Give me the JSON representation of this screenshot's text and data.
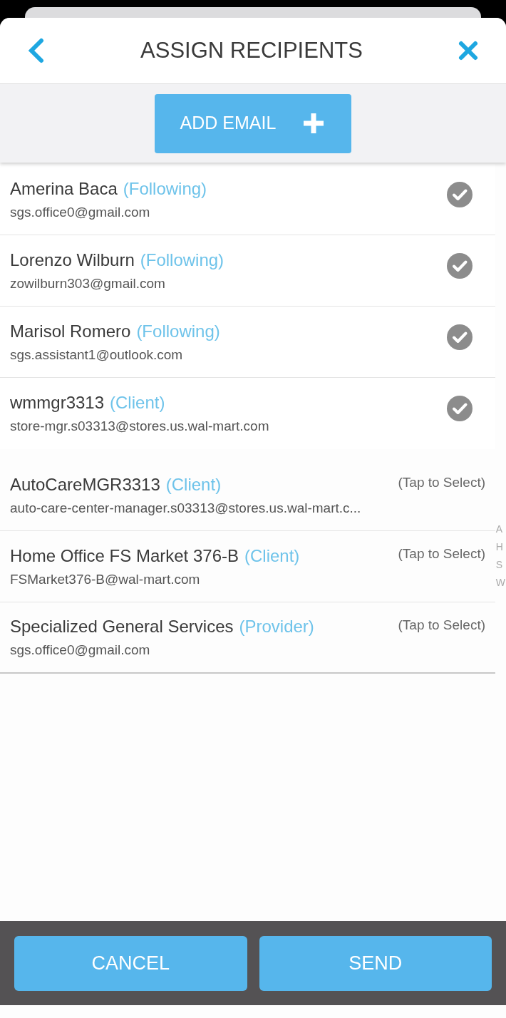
{
  "header": {
    "title": "ASSIGN RECIPIENTS"
  },
  "add_button": {
    "label": "ADD EMAIL"
  },
  "recipient_groups": [
    [
      {
        "name": "Amerina Baca",
        "role": "(Following)",
        "email": "sgs.office0@gmail.com",
        "selected": true
      },
      {
        "name": "Lorenzo Wilburn",
        "role": "(Following)",
        "email": "zowilburn303@gmail.com",
        "selected": true
      },
      {
        "name": "Marisol Romero",
        "role": "(Following)",
        "email": "sgs.assistant1@outlook.com",
        "selected": true
      },
      {
        "name": "wmmgr3313",
        "role": "(Client)",
        "email": "store-mgr.s03313@stores.us.wal-mart.com",
        "selected": true
      }
    ],
    [
      {
        "name": "AutoCareMGR3313",
        "role": "(Client)",
        "email": "auto-care-center-manager.s03313@stores.us.wal-mart.c...",
        "selected": false,
        "hint": "(Tap to Select)"
      },
      {
        "name": "Home Office FS Market 376-B",
        "role": "(Client)",
        "email": "FSMarket376-B@wal-mart.com",
        "selected": false,
        "hint": "(Tap to Select)"
      },
      {
        "name": "Specialized General Services",
        "role": "(Provider)",
        "email": "sgs.office0@gmail.com",
        "selected": false,
        "hint": "(Tap to Select)"
      }
    ]
  ],
  "side_letters": [
    "A",
    "H",
    "S",
    "W"
  ],
  "footer": {
    "buttons": [
      "CANCEL",
      "SEND"
    ]
  }
}
